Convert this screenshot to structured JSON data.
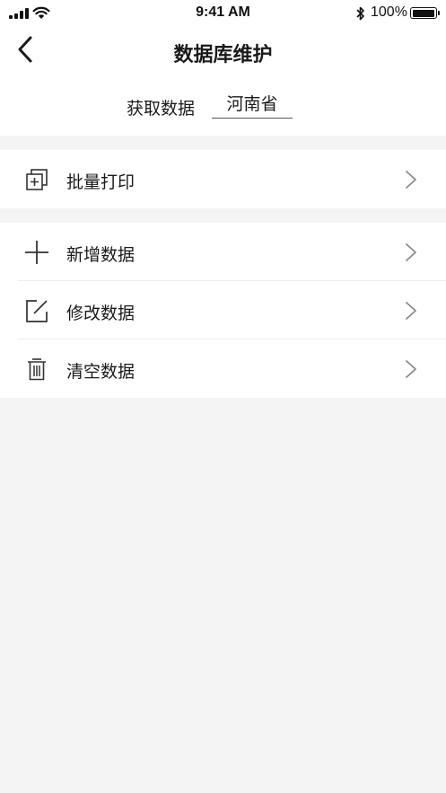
{
  "status_bar": {
    "time": "9:41 AM",
    "battery_percent": "100%",
    "battery_level": 1.0
  },
  "nav": {
    "title": "数据库维护",
    "back_icon": "chevron-left-icon"
  },
  "fetch": {
    "label": "获取数据",
    "province_value": "河南省"
  },
  "menu": {
    "batch_print": {
      "label": "批量打印",
      "icon": "print-copy-icon"
    },
    "add_data": {
      "label": "新增数据",
      "icon": "plus-icon"
    },
    "edit_data": {
      "label": "修改数据",
      "icon": "edit-icon"
    },
    "clear_data": {
      "label": "清空数据",
      "icon": "trash-icon"
    }
  },
  "colors": {
    "background": "#f4f4f4",
    "surface": "#ffffff",
    "text": "#1a1a1a",
    "icon": "#333333",
    "chevron": "#8a8a8a"
  }
}
